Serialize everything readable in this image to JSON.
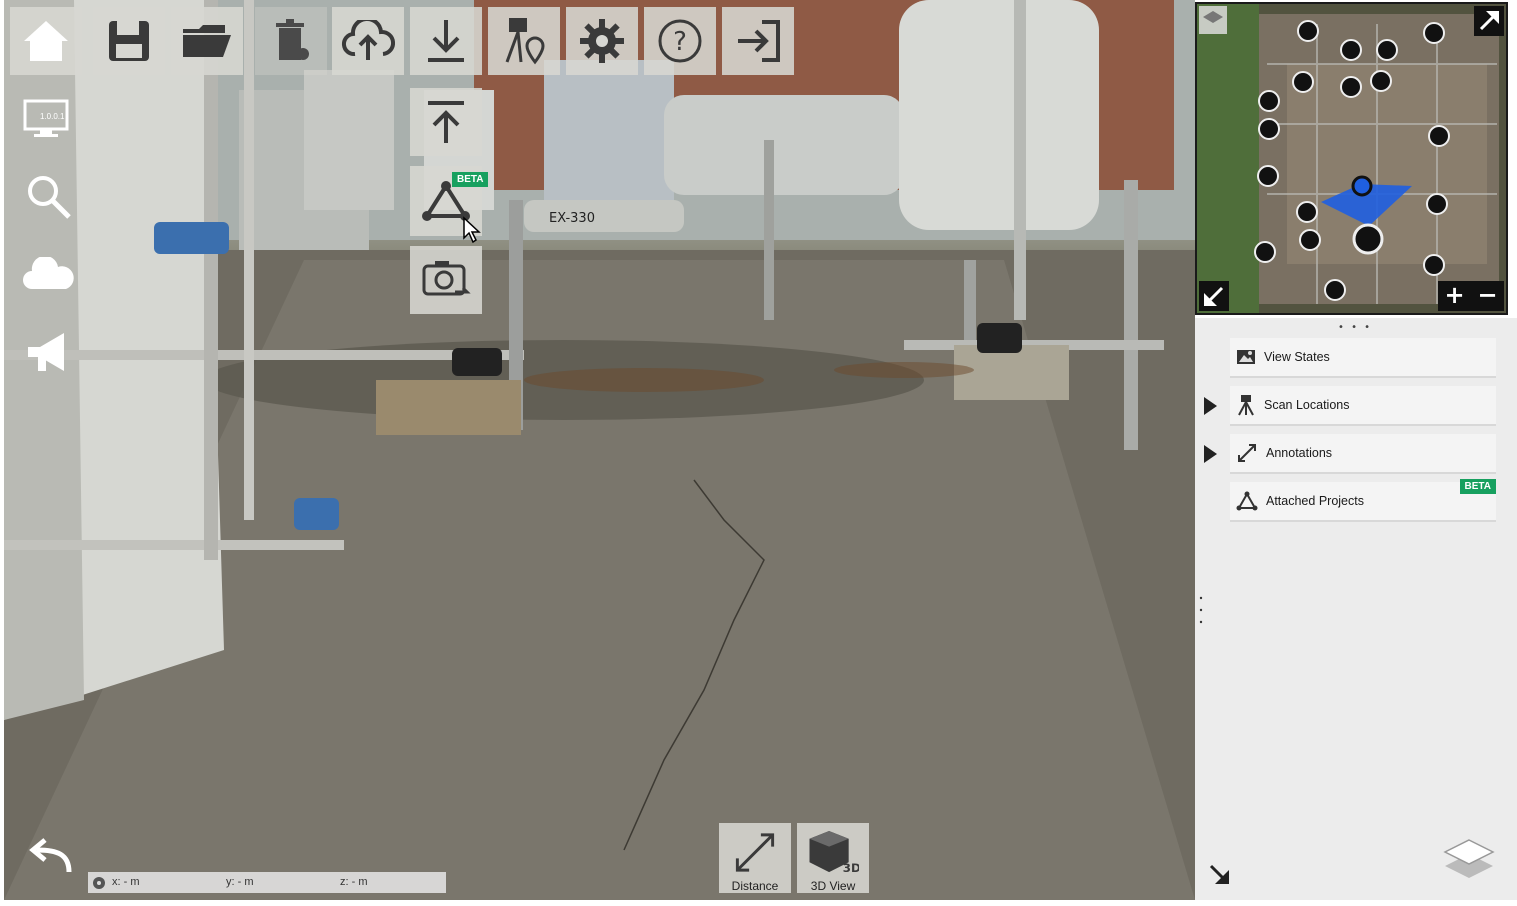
{
  "toolbar": {
    "home": "home-icon",
    "save": "save-icon",
    "open": "open-folder-icon",
    "delete": "trash-icon",
    "upload": "cloud-upload-icon",
    "download": "download-icon",
    "scan_location": "scan-location-icon",
    "settings": "gear-icon",
    "help": "help-icon",
    "exit": "exit-icon"
  },
  "dropdown": {
    "upload_arrow": "upload-arrow-icon",
    "attached_projects": "attached-projects-icon",
    "attached_badge": "BETA",
    "screenshot": "screenshot-icon"
  },
  "left_sidebar": {
    "version": "1.0.0.1",
    "items": [
      "monitor-icon",
      "search-icon",
      "cloud-icon",
      "megaphone-icon"
    ],
    "back": "back-arrow-icon"
  },
  "minimap": {
    "zoom_in": "+",
    "zoom_out": "−"
  },
  "panel": {
    "items": [
      {
        "label": "View States",
        "icon": "image-icon",
        "expandable": false
      },
      {
        "label": "Scan Locations",
        "icon": "tripod-icon",
        "expandable": true
      },
      {
        "label": "Annotations",
        "icon": "measure-line-icon",
        "expandable": true
      },
      {
        "label": "Attached Projects",
        "icon": "attached-projects-icon",
        "expandable": false,
        "badge": "BETA"
      }
    ]
  },
  "coords": {
    "x": "x:  -   m",
    "y": "y:  -   m",
    "z": "z:  -   m"
  },
  "bottom": {
    "distance": "Distance",
    "view3d": "3D View",
    "view3d_glyph": "3D"
  },
  "colors": {
    "beta_badge": "#17a05f",
    "frustum": "#1f5fe0",
    "toolbar_bg": "#d7d7d2"
  }
}
